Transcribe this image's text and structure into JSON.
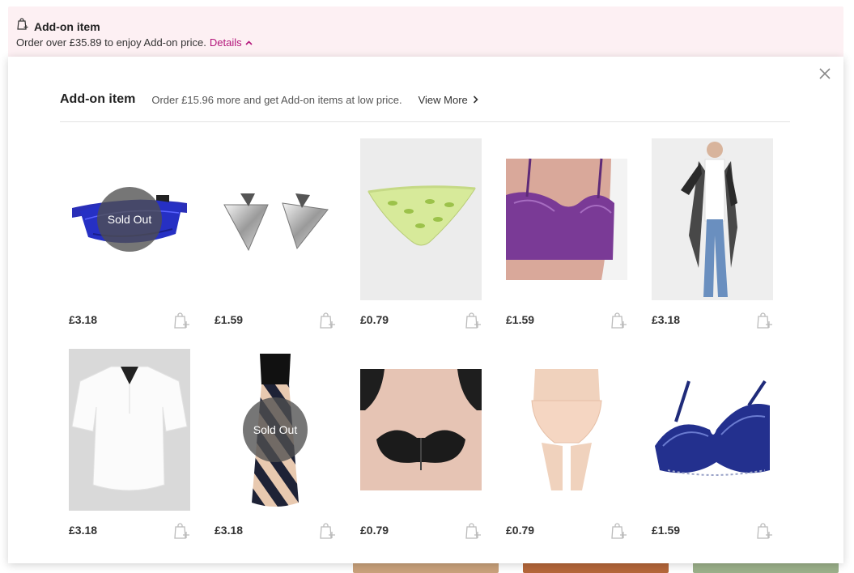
{
  "addon_bar": {
    "title": "Add-on item",
    "subtitle": "Order over £35.89 to enjoy Add-on price.",
    "details_label": "Details",
    "accent_color": "#b3157a",
    "background_color": "#fdf0f3"
  },
  "panel": {
    "title": "Add-on item",
    "description": "Order £15.96 more and get Add-on items at low price.",
    "view_more_label": "View More",
    "close_icon": "close-icon"
  },
  "products": [
    {
      "name": "waist-bag",
      "price": "£3.18",
      "sold_out": true,
      "sold_out_label": "Sold Out"
    },
    {
      "name": "triangle-earrings",
      "price": "£1.59",
      "sold_out": false
    },
    {
      "name": "leaf-print-panties",
      "price": "£0.79",
      "sold_out": false
    },
    {
      "name": "purple-lace-bra",
      "price": "£1.59",
      "sold_out": false
    },
    {
      "name": "sheer-black-cardigan",
      "price": "£3.18",
      "sold_out": false
    },
    {
      "name": "white-blouse",
      "price": "£3.18",
      "sold_out": false
    },
    {
      "name": "striped-maxi-dress",
      "price": "£3.18",
      "sold_out": true,
      "sold_out_label": "Sold Out"
    },
    {
      "name": "strapless-bra",
      "price": "£0.79",
      "sold_out": false
    },
    {
      "name": "nude-panties",
      "price": "£0.79",
      "sold_out": false
    },
    {
      "name": "navy-lace-bra",
      "price": "£1.59",
      "sold_out": false
    }
  ]
}
